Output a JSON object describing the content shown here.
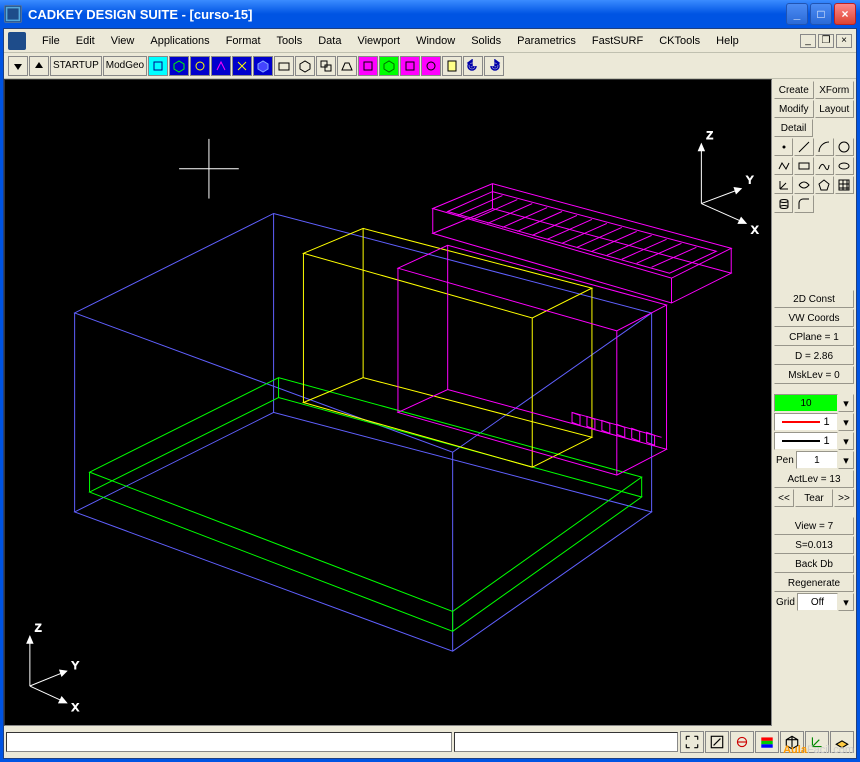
{
  "title": "CADKEY DESIGN SUITE - [curso-15]",
  "menu": [
    "File",
    "Edit",
    "View",
    "Applications",
    "Format",
    "Tools",
    "Data",
    "Viewport",
    "Window",
    "Solids",
    "Parametrics",
    "FastSURF",
    "CKTools",
    "Help"
  ],
  "toolbar": {
    "startup": "STARTUP",
    "modgeo": "ModGeo"
  },
  "right": {
    "tabs": {
      "create": "Create",
      "xform": "XForm",
      "modify": "Modify",
      "layout": "Layout",
      "detail": "Detail"
    },
    "const2d": "2D Const",
    "vwcoords": "VW Coords",
    "cplane": "CPlane = 1",
    "d": "D = 2.86",
    "msklev": "MskLev = 0",
    "color": "10",
    "ltype1": "1",
    "ltype2": "1",
    "pen_lbl": "Pen",
    "pen": "1",
    "actlev": "ActLev = 13",
    "tear": "Tear",
    "prev": "<<",
    "next": ">>",
    "view": "View = 7",
    "s": "S=0.013",
    "backdb": "Back Db",
    "regen": "Regenerate",
    "grid_lbl": "Grid",
    "grid": "Off"
  },
  "axis": {
    "x": "X",
    "y": "Y",
    "z": "Z"
  },
  "watermark": {
    "brand": "Aula",
    "rest": "Facil.com"
  }
}
